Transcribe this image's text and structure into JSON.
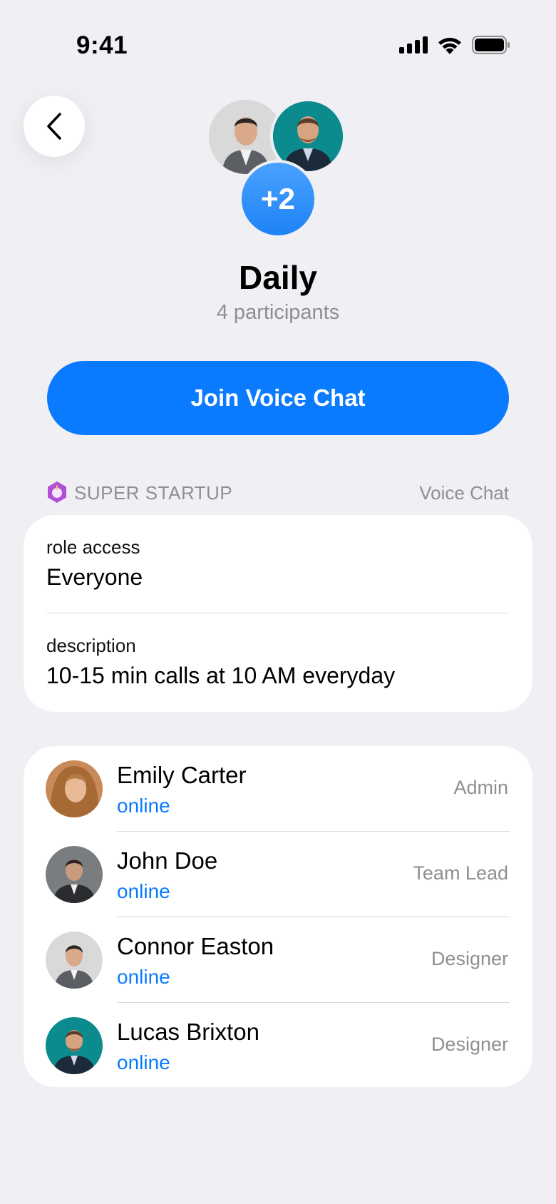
{
  "status_bar": {
    "time": "9:41"
  },
  "group": {
    "extra_count": "+2",
    "title": "Daily",
    "subtitle": "4 participants",
    "join_label": "Join Voice Chat"
  },
  "section": {
    "org_name": "SUPER STARTUP",
    "right_label": "Voice Chat"
  },
  "info": {
    "role_label": "role access",
    "role_value": "Everyone",
    "desc_label": "description",
    "desc_value": "10-15 min calls at 10 AM everyday"
  },
  "members": [
    {
      "name": "Emily Carter",
      "status": "online",
      "role": "Admin"
    },
    {
      "name": "John Doe",
      "status": "online",
      "role": "Team Lead"
    },
    {
      "name": "Connor Easton",
      "status": "online",
      "role": "Designer"
    },
    {
      "name": "Lucas Brixton",
      "status": "online",
      "role": "Designer"
    }
  ],
  "colors": {
    "accent": "#0a7bff",
    "background": "#efeff4",
    "muted": "#8e8e93"
  }
}
